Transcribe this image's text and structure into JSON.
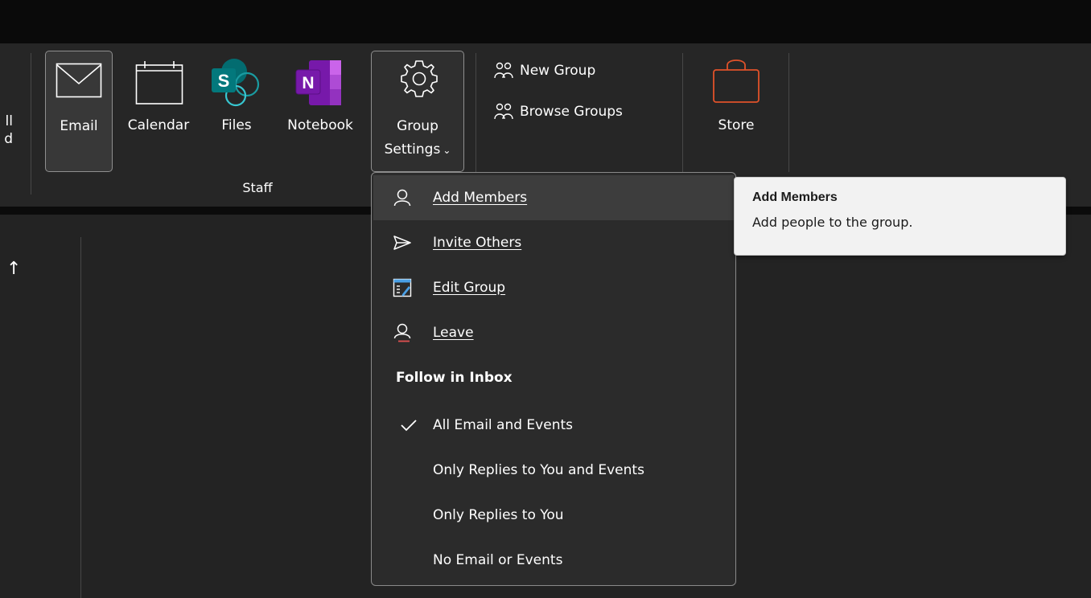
{
  "ribbon": {
    "clipped_left_label": "ll\nd",
    "buttons": {
      "email": "Email",
      "calendar": "Calendar",
      "files": "Files",
      "notebook": "Notebook",
      "group_settings_line1": "Group",
      "group_settings_line2": "Settings",
      "store": "Store"
    },
    "group_label": "Staff",
    "new_group": "New Group",
    "browse_groups": "Browse Groups",
    "files_badge": "S",
    "notebook_badge": "N"
  },
  "menu": {
    "items": [
      {
        "label": "Add Members",
        "icon": "person-icon"
      },
      {
        "label": "Invite Others",
        "icon": "send-icon"
      },
      {
        "label": "Edit Group",
        "icon": "edit-group-icon"
      },
      {
        "label": "Leave",
        "icon": "person-leave-icon"
      }
    ],
    "follow_heading": "Follow in Inbox",
    "follow_options": [
      {
        "label": "All Email and Events",
        "checked": true
      },
      {
        "label": "Only Replies to You and Events",
        "checked": false
      },
      {
        "label": "Only Replies to You",
        "checked": false
      },
      {
        "label": "No Email or Events",
        "checked": false
      }
    ]
  },
  "tooltip": {
    "title": "Add Members",
    "description": "Add people to the group."
  },
  "list": {
    "sort_arrow": "↑"
  },
  "colors": {
    "store_accent": "#e0522a",
    "files_accent": "#038387",
    "notebook_accent": "#7719aa"
  }
}
